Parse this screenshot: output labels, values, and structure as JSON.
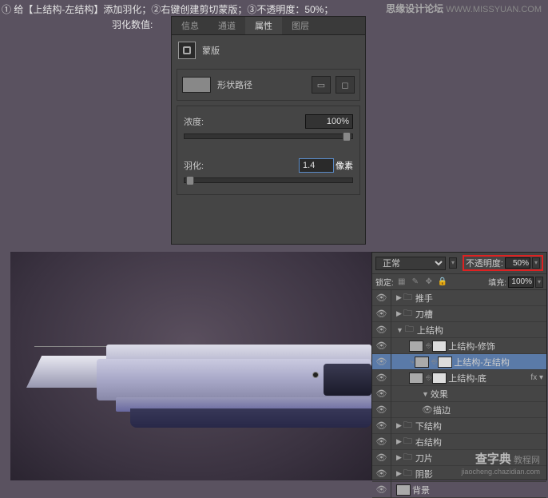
{
  "instruction": "① 给【上结构-左结构】添加羽化；②右键创建剪切蒙版；③不透明度：50%；",
  "watermark_top": {
    "brand": "思缘设计论坛",
    "url": "WWW.MISSYUAN.COM"
  },
  "feather_label": "羽化数值:",
  "props": {
    "tabs": [
      "信息",
      "通道",
      "属性",
      "图层"
    ],
    "active_tab": 2,
    "mask_label": "蒙版",
    "shape_label": "形状路径",
    "density_label": "浓度:",
    "density_value": "100%",
    "feather_label": "羽化:",
    "feather_value": "1.4",
    "feather_unit": "像素"
  },
  "layers": {
    "blend_mode": "正常",
    "opacity_label": "不透明度:",
    "opacity_value": "50%",
    "lock_label": "锁定:",
    "fill_label": "填充:",
    "fill_value": "100%",
    "items": [
      {
        "indent": 0,
        "type": "folder",
        "open": false,
        "name": "推手",
        "vis": true
      },
      {
        "indent": 0,
        "type": "folder",
        "open": false,
        "name": "刀槽",
        "vis": true
      },
      {
        "indent": 0,
        "type": "folder",
        "open": true,
        "name": "上结构",
        "vis": true
      },
      {
        "indent": 1,
        "type": "shape",
        "name": "上结构-修饰",
        "vis": true
      },
      {
        "indent": 1,
        "type": "shape",
        "name": "上结构-左结构",
        "vis": true,
        "selected": true,
        "clip": true
      },
      {
        "indent": 1,
        "type": "shape",
        "name": "上结构-底",
        "vis": true,
        "fx": true
      },
      {
        "indent": 2,
        "type": "fx-head",
        "name": "效果",
        "vis": true
      },
      {
        "indent": 2,
        "type": "fx-item",
        "name": "描边",
        "vis": true
      },
      {
        "indent": 0,
        "type": "folder",
        "open": false,
        "name": "下结构",
        "vis": true
      },
      {
        "indent": 0,
        "type": "folder",
        "open": false,
        "name": "右结构",
        "vis": true
      },
      {
        "indent": 0,
        "type": "folder",
        "open": false,
        "name": "刀片",
        "vis": true
      },
      {
        "indent": 0,
        "type": "folder",
        "open": false,
        "name": "阴影",
        "vis": true
      },
      {
        "indent": 0,
        "type": "bg",
        "name": "背景",
        "vis": true
      }
    ]
  },
  "watermark_bot": {
    "brand": "查字典",
    "suffix": "教程网",
    "url": "jiaocheng.chazidian.com"
  }
}
